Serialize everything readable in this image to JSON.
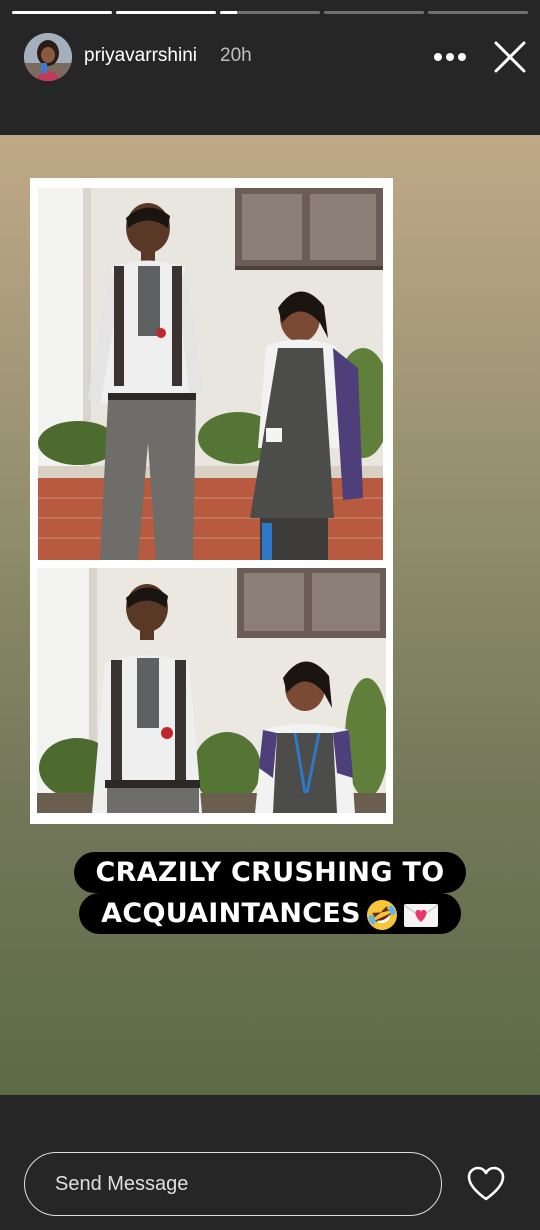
{
  "header": {
    "username": "priyavarrshini",
    "time": "20h",
    "progress": [
      1,
      1,
      0.17,
      0,
      0
    ],
    "icons": {
      "more": "more-horizontal-icon",
      "close": "close-icon"
    }
  },
  "story": {
    "caption_line1": "CRAZILY CRUSHING TO",
    "caption_line2": "ACQUAINTANCES",
    "caption_emojis": [
      "rolling-on-floor-laughing-emoji",
      "love-letter-emoji"
    ]
  },
  "footer": {
    "message_placeholder": "Send Message",
    "icons": {
      "like": "heart-icon"
    }
  },
  "colors": {
    "bar_background": "#262626",
    "story_gradient_top": "#c0a987",
    "story_gradient_bottom": "#5c6a47",
    "caption_background": "#000000",
    "text": "#ffffff"
  }
}
